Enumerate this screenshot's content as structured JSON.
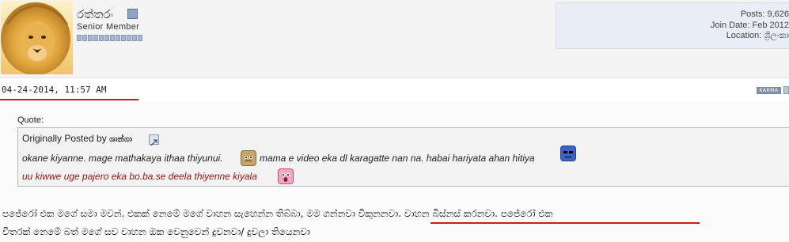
{
  "user": {
    "name": "රත්තරං",
    "title": "Senior Member",
    "reputation_pips": 12
  },
  "userinfo": {
    "posts": "Posts: 9,626",
    "join_date": "Join Date: Feb 2012",
    "location": "Location: ශ්‍රීලංකා"
  },
  "post": {
    "date": "04-24-2014, 11:57 AM",
    "karma_label": "KARMA"
  },
  "quote": {
    "label": "Quote:",
    "prefix": "Originally Posted by",
    "author": "ශාන්ගා",
    "line1": "okane kiyanne. mage mathakaya ithaa thiyunui.",
    "line1b": "mama e video eka dl karagatte nan na. habai hariyata ahan hitiya",
    "line2": "uu kiwwe uge pajero eka bo.ba.se deela thiyenne kiyala",
    "line1_color": "#222222",
    "line2_color": "#9b1111"
  },
  "body": {
    "line1": "පජේරෝ එක මගේ සමා මවන්. එකක් නෙමේ මගේ වාහන සැහෙන්න තිබ්බා, මම ගන්නවා විකුනනවා. වාහන බිස්නස් කරනවා. පජේරෝ එක",
    "line2": "විතරක් නෙමේ බත් මගේ සව වාහන ඔක වෙනුවෙන් දුවනවා/ දුවලා තියෙනවා"
  },
  "colors": {
    "highlight": "#d21a1a"
  }
}
